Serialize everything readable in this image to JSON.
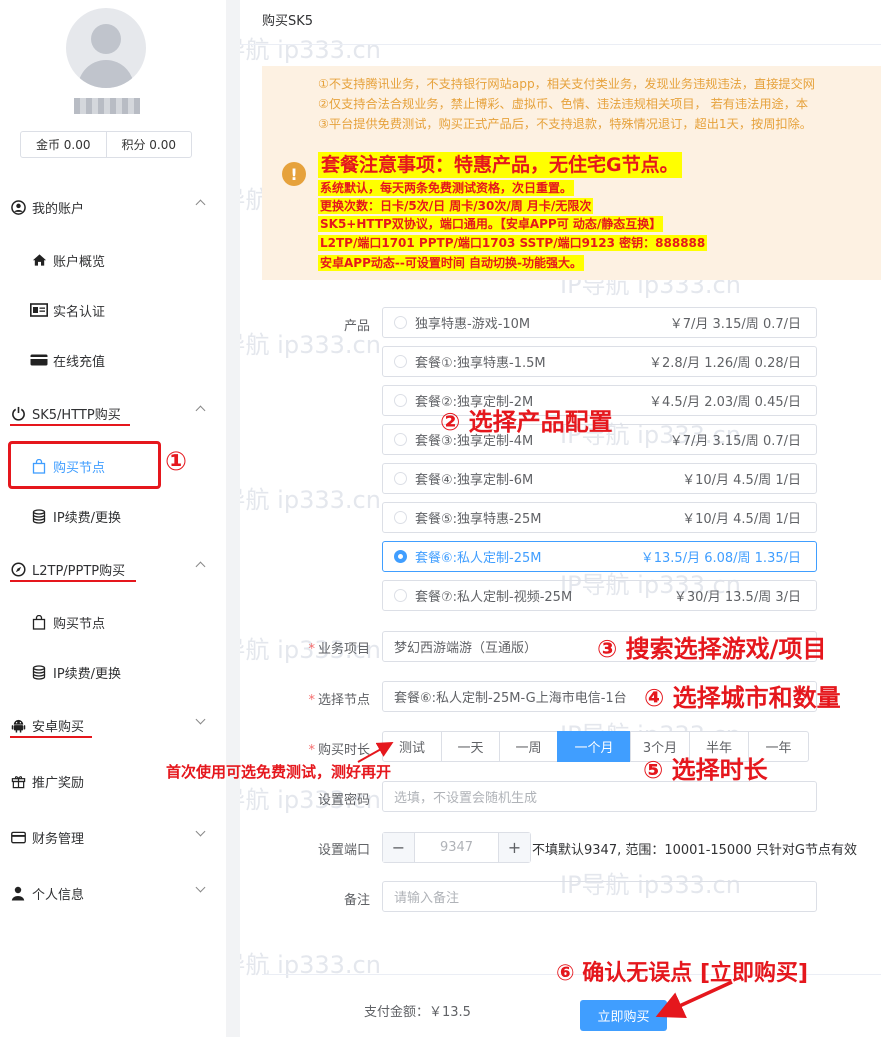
{
  "sidebar": {
    "balance": {
      "coins": "金币 0.00",
      "points": "积分 0.00"
    },
    "groups": [
      {
        "label": "我的账户",
        "icon": "user-icon",
        "items": [
          "账户概览",
          "实名认证",
          "在线充值"
        ]
      },
      {
        "label": "SK5/HTTP购买",
        "icon": "power-icon",
        "items": [
          "购买节点",
          "IP续费/更换"
        ]
      },
      {
        "label": "L2TP/PPTP购买",
        "icon": "compass-icon",
        "items": [
          "购买节点",
          "IP续费/更换"
        ]
      },
      {
        "label": "安卓购买",
        "icon": "android-icon"
      },
      {
        "label": "推广奖励",
        "icon": "gift-icon"
      },
      {
        "label": "财务管理",
        "icon": "card-icon"
      },
      {
        "label": "个人信息",
        "icon": "person-icon"
      }
    ]
  },
  "main": {
    "title": "购买SK5",
    "notice": {
      "lines": [
        "①不支持腾讯业务，不支持银行网站app，相关支付类业务，发现业务违规违法，直接提交网",
        "②仅支持合法合规业务，禁止博彩、虚拟币、色情、违法违规相关项目， 若有违法用途，本",
        "③平台提供免费测试，购买正式产品后，不支持退款，特殊情况退订，超出1天，按周扣除。"
      ],
      "headline": "套餐注意事项：特惠产品，无住宅G节点。",
      "highlights": [
        "系统默认，每天两条免费测试资格，次日重置。",
        "更换次数：日卡/5次/日  周卡/30次/周  月卡/无限次",
        "SK5+HTTP双协议，端口通用。【安卓APP可 动态/静态互换】",
        "L2TP/端口1701   PPTP/端口1703  SSTP/端口9123  密钥：888888",
        "安卓APP动态--可设置时间 自动切换-功能强大。"
      ]
    },
    "labels": {
      "product": "产品",
      "business": "业务项目",
      "node": "选择节点",
      "duration": "购买时长",
      "password": "设置密码",
      "port": "设置端口",
      "remark": "备注"
    },
    "products": [
      {
        "name": "独享特惠-游戏-10M",
        "price": "￥7/月 3.15/周 0.7/日"
      },
      {
        "name": "套餐①:独享特惠-1.5M",
        "price": "￥2.8/月 1.26/周 0.28/日"
      },
      {
        "name": "套餐②:独享定制-2M",
        "price": "￥4.5/月 2.03/周 0.45/日"
      },
      {
        "name": "套餐③:独享定制-4M",
        "price": "￥7/月 3.15/周 0.7/日"
      },
      {
        "name": "套餐④:独享定制-6M",
        "price": "￥10/月 4.5/周 1/日"
      },
      {
        "name": "套餐⑤:独享特惠-25M",
        "price": "￥10/月 4.5/周 1/日"
      },
      {
        "name": "套餐⑥:私人定制-25M",
        "price": "￥13.5/月 6.08/周 1.35/日"
      },
      {
        "name": "套餐⑦:私人定制-视频-25M",
        "price": "￥30/月 13.5/周 3/日"
      }
    ],
    "selected_product": 6,
    "business_value": "梦幻西游端游（互通版）",
    "node_value": "套餐⑥:私人定制-25M-G上海市电信-1台",
    "durations": [
      "测试",
      "一天",
      "一周",
      "一个月",
      "3个月",
      "半年",
      "一年"
    ],
    "selected_duration": 3,
    "password_placeholder": "选填，不设置会随机生成",
    "port_value": "9347",
    "port_hint": "不填默认9347, 范围：10001-15000 只针对G节点有效",
    "remark_placeholder": "请输入备注",
    "pay_label": "支付金额：￥13.5",
    "buy_button": "立即购买"
  },
  "annotations": {
    "a1": "①",
    "a2": "② 选择产品配置",
    "a3": "③ 搜索选择游戏/项目",
    "a4": "④ 选择城市和数量",
    "a5": "⑤ 选择时长",
    "a6": "⑥ 确认无误点 [立即购买]",
    "test_tip": "首次使用可选免费测试，测好再开"
  },
  "watermark": "IP导航  ip333.cn",
  "colors": {
    "primary": "#409eff",
    "annotation": "#e5171d",
    "notice_bg": "#fdf1e2",
    "notice_text": "#e6a23c",
    "highlight": "#ffff00"
  }
}
